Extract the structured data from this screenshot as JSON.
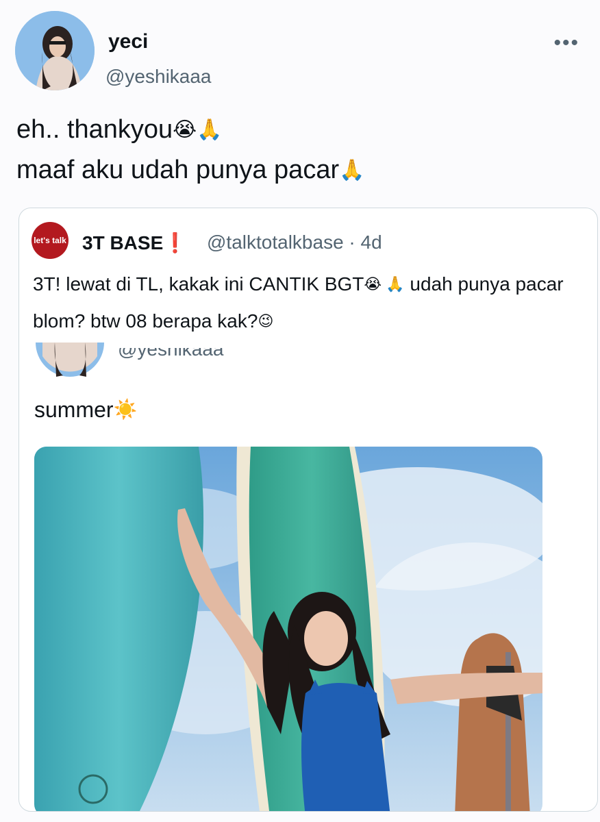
{
  "author": {
    "display_name": "yeci",
    "handle": "@yeshikaaa",
    "avatar_icon": "profile-photo"
  },
  "more_icon": "more-horizontal-icon",
  "more_glyph": "•••",
  "tweet": {
    "line1": "eh.. thankyou",
    "line1_emojis": "😭🙏",
    "line2": "maaf aku udah punya pacar",
    "line2_emoji": "🙏"
  },
  "quote": {
    "logo_text": "let's talk",
    "name": "3T BASE",
    "name_mark": "❗",
    "handle_time": "@talktotalkbase · 4d",
    "text_part1": "3T! lewat di TL, kakak ini CANTIK BGT",
    "text_emojis": "😭 🙏",
    "text_part2": "udah punya pacar blom?  btw 08 berapa kak?",
    "text_emoji_end": "😉",
    "inner": {
      "handle": "@yeshikaaa",
      "text": "summer",
      "emoji": "☀️"
    }
  },
  "colors": {
    "brand_red": "#b3191f",
    "muted_text": "#536471",
    "border": "#cfd9de",
    "sky": "#7fb2df",
    "board_teal": "#49b1b8"
  }
}
